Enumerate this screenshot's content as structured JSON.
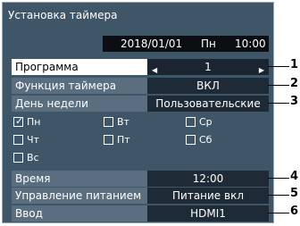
{
  "window": {
    "title": "Установка таймера"
  },
  "datebar": {
    "date": "2018/01/01",
    "weekday": "Пн",
    "time": "10:00"
  },
  "rows": [
    {
      "label": "Программа",
      "value": "1"
    },
    {
      "label": "Функция таймера",
      "value": "ВКЛ"
    },
    {
      "label": "День недели",
      "value": "Пользовательские"
    },
    {
      "label": "Время",
      "value": "12:00"
    },
    {
      "label": "Управление питанием",
      "value": "Питание вкл"
    },
    {
      "label": "Ввод",
      "value": "HDMI1"
    }
  ],
  "days": [
    {
      "label": "Пн",
      "checked": true
    },
    {
      "label": "Вт",
      "checked": false
    },
    {
      "label": "Ср",
      "checked": false
    },
    {
      "label": "Чт",
      "checked": false
    },
    {
      "label": "Пт",
      "checked": false
    },
    {
      "label": "Сб",
      "checked": false
    },
    {
      "label": "Вс",
      "checked": false
    }
  ],
  "callouts": [
    "1",
    "2",
    "3",
    "4",
    "5",
    "6"
  ],
  "colors": {
    "panel": "#3f5668",
    "value_bg": "#1e2a35",
    "row_bg": "#5a6e7f"
  }
}
